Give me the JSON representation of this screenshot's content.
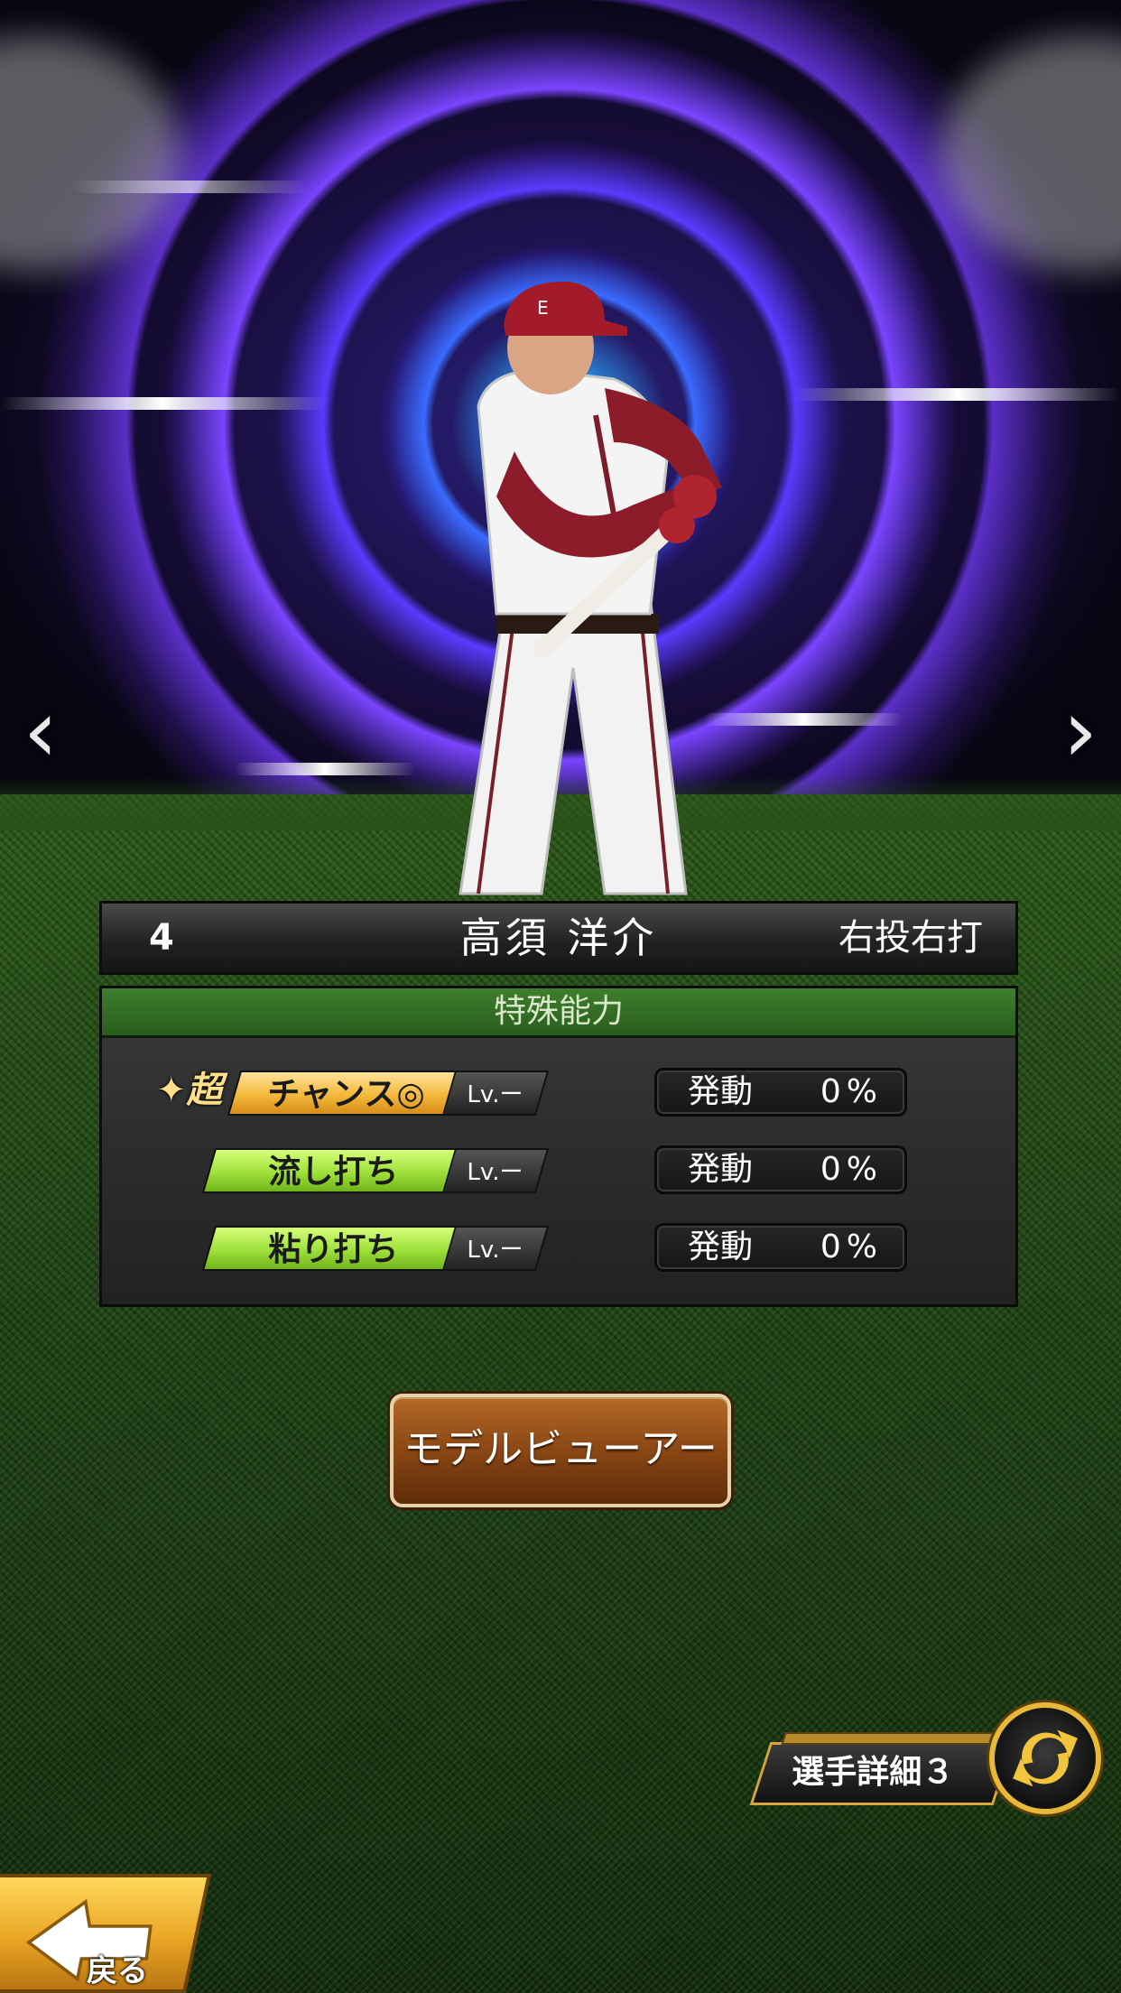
{
  "navigation": {
    "prev_glyph": "‹",
    "next_glyph": "›"
  },
  "player": {
    "number": "4",
    "name": "高須 洋介",
    "handedness": "右投右打"
  },
  "abilities": {
    "title": "特殊能力",
    "items": [
      {
        "prefix": "超",
        "name": "チャンス◎",
        "level": "Lv.ー",
        "status_label": "発動",
        "rate": "0%",
        "style": "gold"
      },
      {
        "prefix": "",
        "name": "流し打ち",
        "level": "Lv.ー",
        "status_label": "発動",
        "rate": "0%",
        "style": "green"
      },
      {
        "prefix": "",
        "name": "粘り打ち",
        "level": "Lv.ー",
        "status_label": "発動",
        "rate": "0%",
        "style": "green"
      }
    ]
  },
  "actions": {
    "model_viewer": "モデルビューアー",
    "detail_switch": "選手詳細３",
    "back": "戻る"
  },
  "colors": {
    "gold_badge": "#f3b83c",
    "green_badge": "#9ee03a",
    "panel_header": "#2a5d1d",
    "button_brown": "#8a4714"
  }
}
